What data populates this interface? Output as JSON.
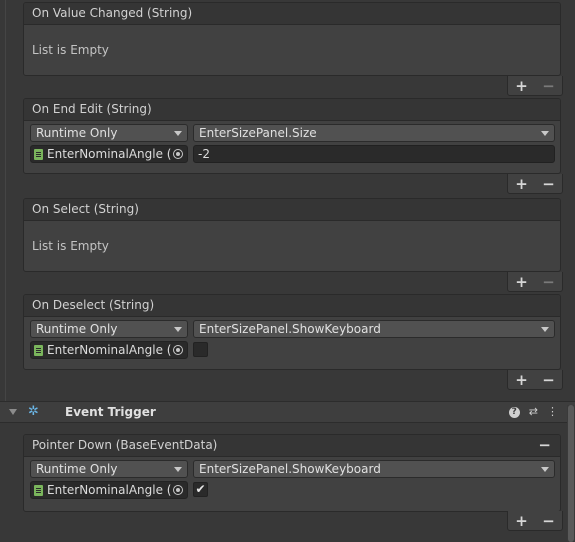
{
  "events": {
    "on_value_changed": {
      "title": "On Value Changed (String)",
      "empty_text": "List is Empty",
      "add": "+",
      "remove": "−"
    },
    "on_end_edit": {
      "title": "On End Edit (String)",
      "runtime": "Runtime Only",
      "function": "EnterSizePanel.Size",
      "object": "EnterNominalAngle (E",
      "argument": "-2",
      "add": "+",
      "remove": "−"
    },
    "on_select": {
      "title": "On Select (String)",
      "empty_text": "List is Empty",
      "add": "+",
      "remove": "−"
    },
    "on_deselect": {
      "title": "On Deselect (String)",
      "runtime": "Runtime Only",
      "function": "EnterSizePanel.ShowKeyboard",
      "object": "EnterNominalAngle (E",
      "checked": false,
      "add": "+",
      "remove": "−"
    }
  },
  "component": {
    "title": "Event Trigger",
    "help_icon": "?",
    "settings_icon": "⇄",
    "menu_icon": "⋮"
  },
  "trigger": {
    "title": "Pointer Down (BaseEventData)",
    "remove_entry": "−",
    "runtime": "Runtime Only",
    "function": "EnterSizePanel.ShowKeyboard",
    "object": "EnterNominalAngle (E",
    "checked": true,
    "check_mark": "✔",
    "add": "+",
    "remove": "−"
  },
  "colors": {
    "background": "#383838",
    "panel": "#414141",
    "header": "#353535",
    "accent_icon": "#6bb7e8"
  }
}
